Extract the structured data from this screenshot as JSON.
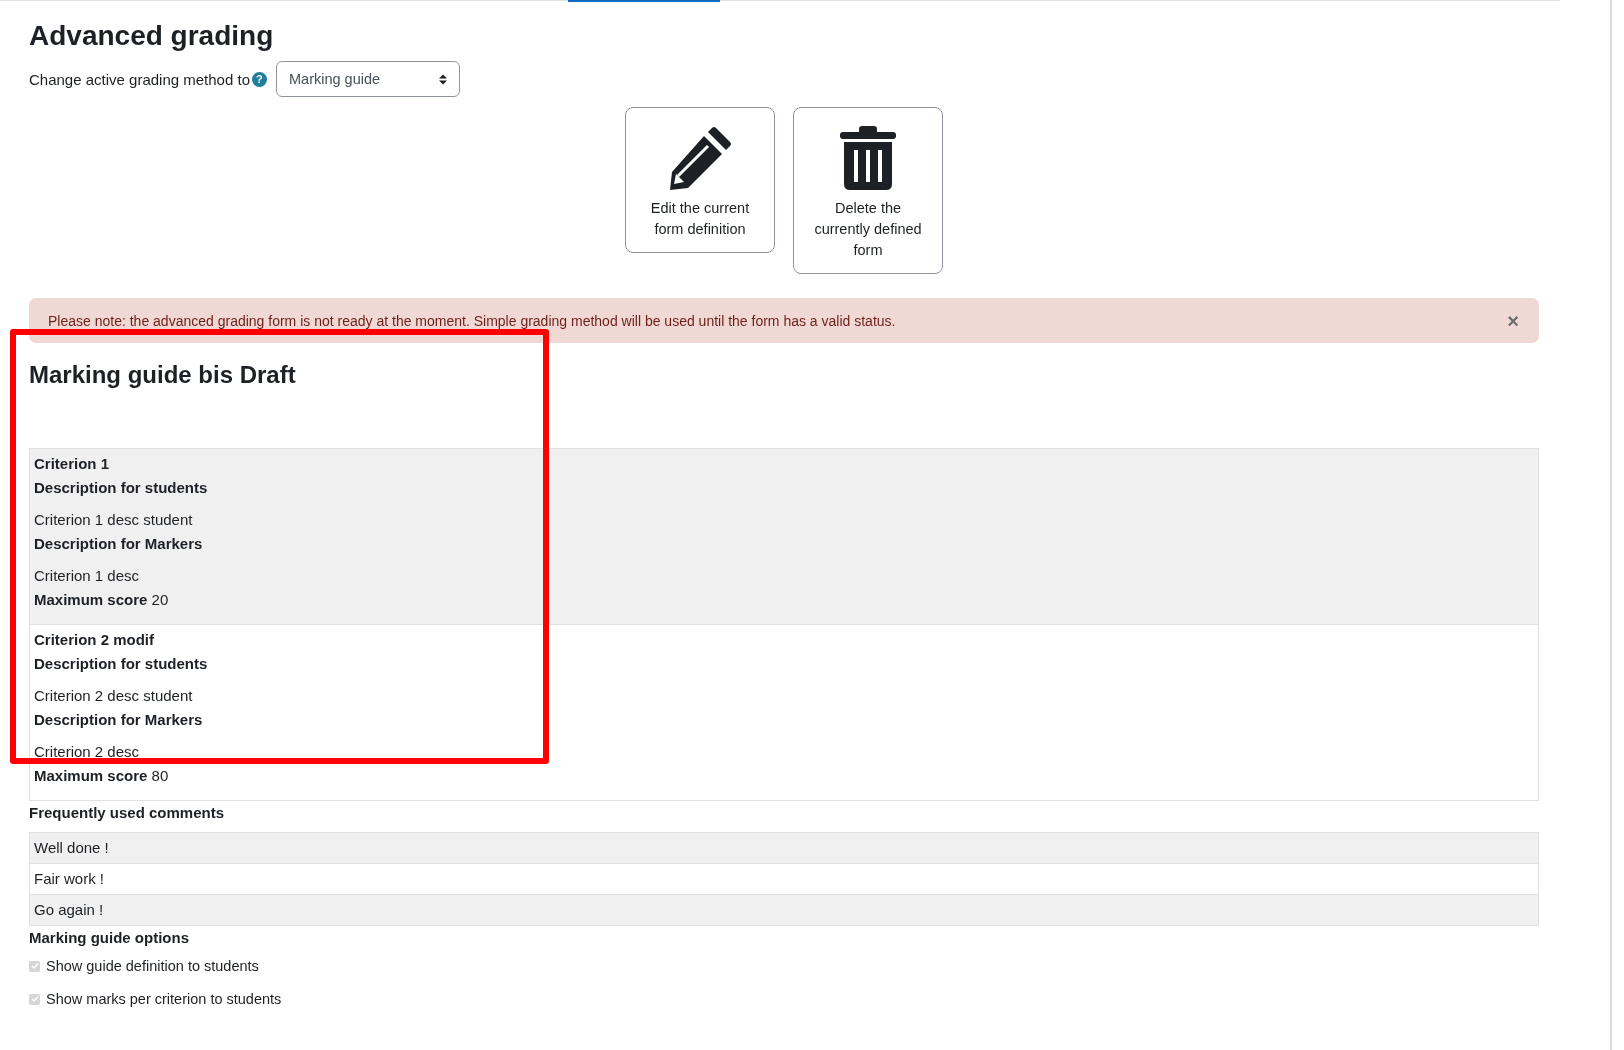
{
  "page": {
    "title": "Advanced grading"
  },
  "method": {
    "label": "Change active grading method to",
    "help": "?",
    "value": "Marking guide"
  },
  "actions": [
    {
      "kind": "edit",
      "label": "Edit the current form definition"
    },
    {
      "kind": "delete",
      "label": "Delete the currently defined form"
    }
  ],
  "alert": {
    "text": "Please note: the advanced grading form is not ready at the moment. Simple grading method will be used until the form has a valid status.",
    "close": "×"
  },
  "guide": {
    "title": "Marking guide bis Draft"
  },
  "criteria": [
    {
      "name": "Criterion 1",
      "students_label": "Description for students",
      "students_desc": "Criterion 1 desc student",
      "markers_label": "Description for Markers",
      "markers_desc": "Criterion 1 desc",
      "max_label": "Maximum score",
      "max_score": "20"
    },
    {
      "name": "Criterion 2 modif",
      "students_label": "Description for students",
      "students_desc": "Criterion 2 desc student",
      "markers_label": "Description for Markers",
      "markers_desc": "Criterion 2 desc",
      "max_label": "Maximum score",
      "max_score": "80"
    }
  ],
  "comments": {
    "heading": "Frequently used comments",
    "items": [
      "Well done !",
      "Fair work !",
      "Go again !"
    ]
  },
  "options": {
    "heading": "Marking guide options",
    "items": [
      {
        "label": "Show guide definition to students",
        "checked": true,
        "disabled": true
      },
      {
        "label": "Show marks per criterion to students",
        "checked": true,
        "disabled": true
      }
    ]
  }
}
